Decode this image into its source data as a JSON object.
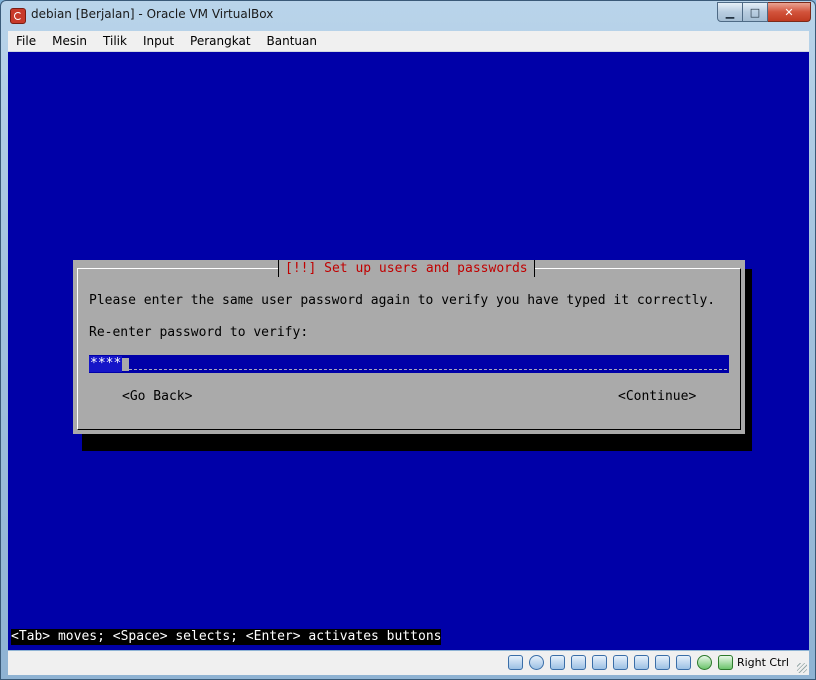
{
  "window": {
    "title": "debian [Berjalan] - Oracle VM VirtualBox",
    "controls": {
      "minimize": "▁",
      "maximize": "□",
      "close": "✕"
    }
  },
  "menubar": {
    "items": [
      "File",
      "Mesin",
      "Tilik",
      "Input",
      "Perangkat",
      "Bantuan"
    ]
  },
  "installer": {
    "dialog_title": "[!!] Set up users and passwords",
    "instruction": "Please enter the same user password again to verify you have typed it correctly.",
    "field_label": "Re-enter password to verify:",
    "password_value": "****",
    "go_back_label": "<Go Back>",
    "continue_label": "<Continue>",
    "hint": "<Tab> moves; <Space> selects; <Enter> activates buttons"
  },
  "statusbar": {
    "icons": [
      "hard-disk-icon",
      "optical-drive-icon",
      "usb-icon",
      "shared-folders-icon",
      "pen-icon",
      "folder-icon",
      "display-icon",
      "network-icon",
      "recording-icon",
      "integration-icon",
      "host-key-arrow-icon"
    ],
    "host_key": "Right Ctrl"
  }
}
